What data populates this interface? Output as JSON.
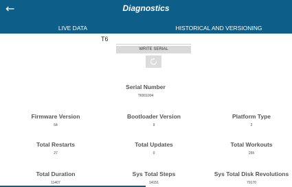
{
  "header": {
    "title": "Diagnostics"
  },
  "tabs": {
    "live": "LIVE DATA",
    "historical": "HISTORICAL AND VERSIONING"
  },
  "serial_entry": {
    "value": "T6",
    "write_label": "WRITE SERIAL"
  },
  "icons": {
    "back": "arrow-left-icon",
    "refresh": "refresh-icon"
  },
  "colors": {
    "app_bar": "#0d5f8a"
  },
  "stats": {
    "serial_number": {
      "label": "Serial Number",
      "value": "T6001004"
    },
    "firmware_version": {
      "label": "Firmware Version",
      "value": "54"
    },
    "bootloader_version": {
      "label": "Bootloader Version",
      "value": "9"
    },
    "platform_type": {
      "label": "Platform Type",
      "value": "2"
    },
    "total_restarts": {
      "label": "Total Restarts",
      "value": "27"
    },
    "total_updates": {
      "label": "Total Updates",
      "value": "0"
    },
    "total_workouts": {
      "label": "Total Workouts",
      "value": "255"
    },
    "total_duration": {
      "label": "Total Duration",
      "value": "11407"
    },
    "sys_total_steps": {
      "label": "Sys Total Steps",
      "value": "14151"
    },
    "sys_total_disk_revolutions": {
      "label": "Sys Total Disk Revolutions",
      "value": "79170"
    }
  }
}
